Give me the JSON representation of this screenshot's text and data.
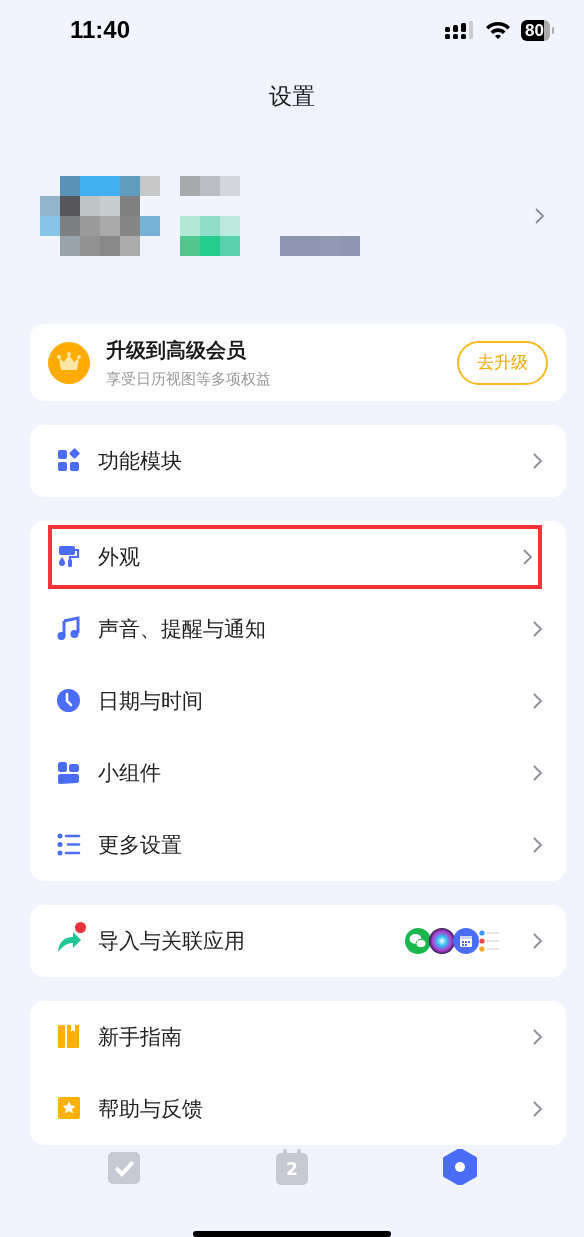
{
  "status_bar": {
    "time": "11:40",
    "battery": "80"
  },
  "title": "设置",
  "upgrade": {
    "title": "升级到高级会员",
    "subtitle": "享受日历视图等多项权益",
    "button": "去升级"
  },
  "groups": [
    {
      "items": [
        {
          "kind": "modules",
          "label": "功能模块",
          "highlighted": false
        }
      ]
    },
    {
      "items": [
        {
          "kind": "brush",
          "label": "外观",
          "highlighted": true
        },
        {
          "kind": "music",
          "label": "声音、提醒与通知",
          "highlighted": false
        },
        {
          "kind": "clock",
          "label": "日期与时间",
          "highlighted": false
        },
        {
          "kind": "widgets",
          "label": "小组件",
          "highlighted": false
        },
        {
          "kind": "list",
          "label": "更多设置",
          "highlighted": false
        }
      ]
    },
    {
      "items": [
        {
          "kind": "import",
          "label": "导入与关联应用",
          "highlighted": false,
          "new": true,
          "linked_apps": [
            {
              "kind": "chat"
            },
            {
              "kind": "orb"
            },
            {
              "kind": "calendar"
            },
            {
              "kind": "list"
            }
          ]
        }
      ]
    },
    {
      "items": [
        {
          "kind": "guide",
          "label": "新手指南",
          "highlighted": false
        },
        {
          "kind": "help",
          "label": "帮助与反馈",
          "highlighted": false
        }
      ]
    }
  ],
  "tabs": [
    {
      "kind": "check",
      "selected": false
    },
    {
      "kind": "calendar",
      "label": "2",
      "selected": false
    },
    {
      "kind": "settings",
      "selected": true
    }
  ]
}
